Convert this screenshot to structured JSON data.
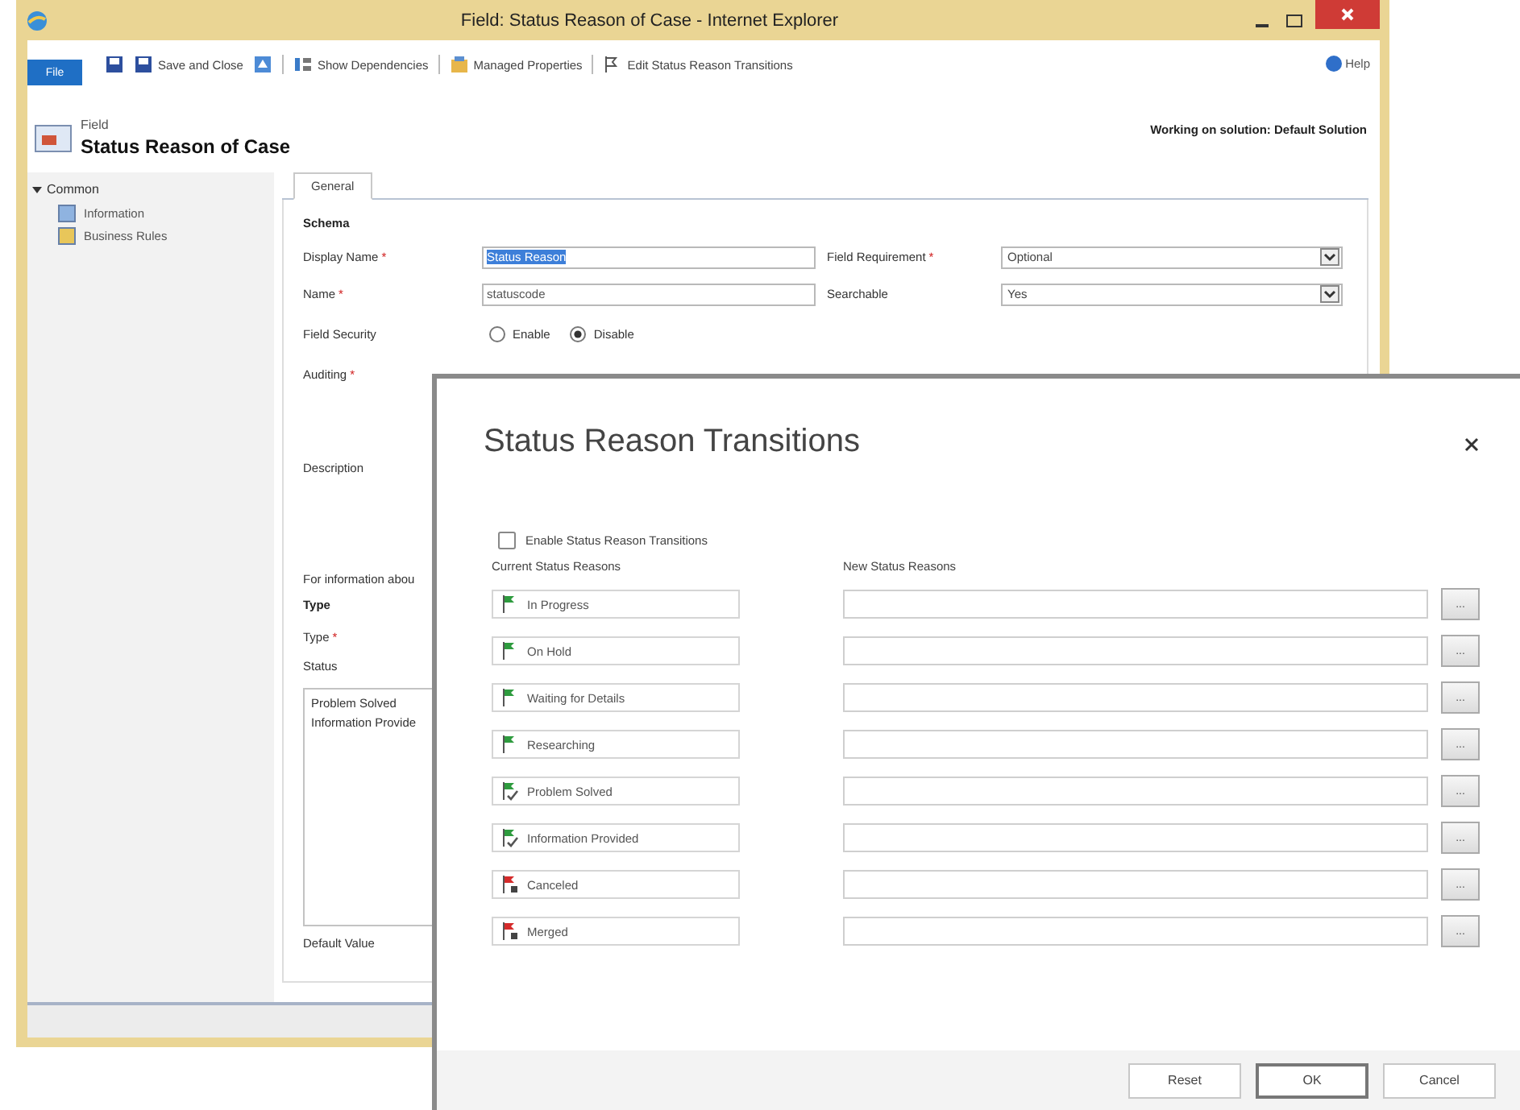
{
  "window": {
    "title": "Field: Status Reason of Case - Internet Explorer"
  },
  "toolbar": {
    "file": "File",
    "items": [
      {
        "kind": "save"
      },
      {
        "kind": "save-close",
        "label": "Save and Close"
      },
      {
        "kind": "publish"
      },
      {
        "kind": "dependencies",
        "label": "Show Dependencies"
      },
      {
        "kind": "properties",
        "label": "Managed Properties"
      },
      {
        "kind": "transitions",
        "label": "Edit Status Reason Transitions"
      }
    ],
    "help": "Help"
  },
  "header": {
    "entity": "Field",
    "title": "Status Reason of Case",
    "solution": "Working on solution: Default Solution"
  },
  "sidebar": {
    "section": "Common",
    "expanded": true,
    "items": [
      {
        "kind": "info",
        "label": "Information"
      },
      {
        "kind": "rules",
        "label": "Business Rules"
      }
    ]
  },
  "tabs": [
    {
      "label": "General",
      "selected": true
    }
  ],
  "form": {
    "section": "Schema",
    "rows": [
      {
        "kind": "input",
        "label": "Display Name",
        "marker": "*",
        "value": "Status Reason",
        "highlighted": true,
        "side": {
          "label": "Field Requirement",
          "marker": "*",
          "value": "Optional"
        }
      },
      {
        "kind": "input",
        "label": "Name",
        "marker": "*",
        "value": "statuscode",
        "highlighted": false,
        "side": {
          "label": "Searchable",
          "value": "Yes"
        }
      },
      {
        "kind": "radio",
        "label": "Field Security",
        "options": [
          {
            "label": "Enable",
            "selected": false
          },
          {
            "label": "Disable",
            "selected": true
          }
        ]
      },
      {
        "kind": "short",
        "label": "Auditing",
        "marker": "*"
      },
      {
        "kind": "tall",
        "label": "Description"
      }
    ],
    "note": "For information abou",
    "type_section": "Type",
    "type_label": {
      "label": "Type",
      "marker": "*"
    },
    "status_label": "Status",
    "status_options": [
      "Problem Solved",
      "Information Provide"
    ],
    "default_label": "Default Value"
  },
  "dialog": {
    "title": "Status Reason Transitions",
    "enable": {
      "label": "Enable Status Reason Transitions",
      "checked": false
    },
    "current_header": "Current Status Reasons",
    "new_header": "New Status Reasons",
    "rows": [
      {
        "kind": "active",
        "label": "In Progress",
        "browse": "..."
      },
      {
        "kind": "active",
        "label": "On Hold",
        "browse": "..."
      },
      {
        "kind": "active",
        "label": "Waiting for Details",
        "browse": "..."
      },
      {
        "kind": "active",
        "label": "Researching",
        "browse": "..."
      },
      {
        "kind": "resolved",
        "label": "Problem Solved",
        "browse": "..."
      },
      {
        "kind": "resolved",
        "label": "Information Provided",
        "browse": "..."
      },
      {
        "kind": "canceled",
        "label": "Canceled",
        "browse": "..."
      },
      {
        "kind": "canceled",
        "label": "Merged",
        "browse": "..."
      }
    ],
    "buttons": [
      {
        "label": "Reset",
        "default": false
      },
      {
        "label": "OK",
        "default": true
      },
      {
        "label": "Cancel",
        "default": false
      }
    ]
  }
}
